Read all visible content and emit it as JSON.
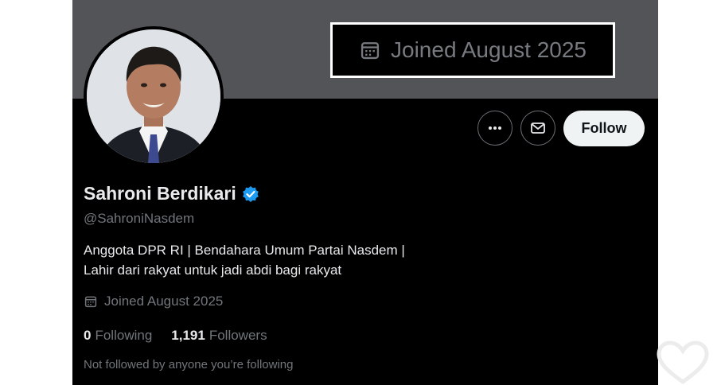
{
  "callout": {
    "text": "Joined August 2025",
    "icon": "calendar-icon"
  },
  "actions": {
    "more_icon": "ellipsis-icon",
    "message_icon": "envelope-icon",
    "follow_label": "Follow"
  },
  "profile": {
    "display_name": "Sahroni Berdikari",
    "verified": true,
    "handle": "@SahroniNasdem",
    "bio_lines": [
      "Anggota DPR RI | Bendahara Umum Partai Nasdem |",
      "Lahir dari rakyat untuk jadi abdi bagi rakyat"
    ],
    "joined": "Joined August 2025"
  },
  "stats": {
    "following_count": "0",
    "following_label": "Following",
    "followers_count": "1,191",
    "followers_label": "Followers"
  },
  "not_followed_text": "Not followed by anyone you’re following",
  "colors": {
    "banner": "#525457",
    "background": "#000000",
    "verified_badge": "#1d9bf0",
    "follow_button": "#eff3f4",
    "muted_text": "#71767b",
    "primary_text": "#e7e9ea"
  }
}
